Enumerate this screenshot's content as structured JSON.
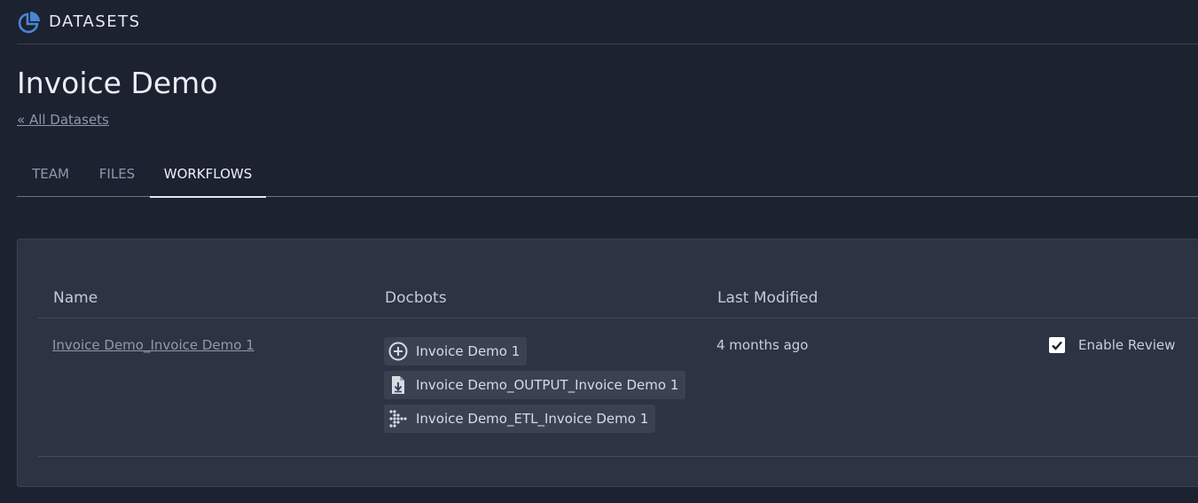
{
  "header": {
    "brand": "DATASETS",
    "logo_icon": "pie-chart-icon",
    "accent": "#4a86d4"
  },
  "page": {
    "title": "Invoice Demo",
    "back_link": "« All Datasets"
  },
  "tabs": [
    {
      "label": "TEAM",
      "active": false
    },
    {
      "label": "FILES",
      "active": false
    },
    {
      "label": "WORKFLOWS",
      "active": true
    }
  ],
  "table": {
    "columns": [
      "Name",
      "Docbots",
      "Last Modified"
    ],
    "rows": [
      {
        "name": "Invoice Demo_Invoice Demo 1",
        "docbots": [
          {
            "icon": "plus-circle-icon",
            "label": "Invoice Demo 1"
          },
          {
            "icon": "file-download-icon",
            "label": "Invoice Demo_OUTPUT_Invoice Demo 1"
          },
          {
            "icon": "dots-arrow-icon",
            "label": "Invoice Demo_ETL_Invoice Demo 1"
          }
        ],
        "last_modified": "4 months ago",
        "review_label": "Enable Review",
        "review_enabled": true
      }
    ]
  }
}
